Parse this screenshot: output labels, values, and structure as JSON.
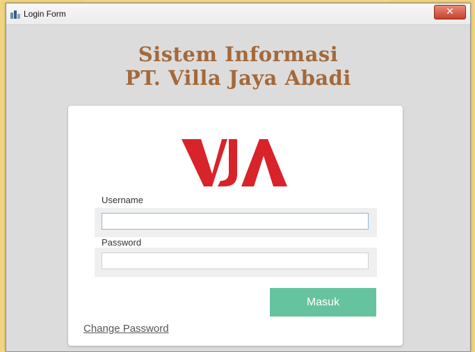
{
  "window": {
    "title": "Login Form",
    "close_label": "✕"
  },
  "header": {
    "line1": "Sistem Informasi",
    "line2": "PT. Villa Jaya Abadi"
  },
  "logo": {
    "text": "VJA",
    "color": "#d8232a"
  },
  "form": {
    "username_label": "Username",
    "username_value": "",
    "password_label": "Password",
    "password_value": "",
    "submit_label": "Masuk",
    "change_password_label": "Change Password"
  },
  "colors": {
    "title": "#a4693a",
    "button": "#66c3a0",
    "background": "#f3d98a"
  },
  "icons": {
    "window_icon": "app-window-icon",
    "close": "close-icon"
  }
}
